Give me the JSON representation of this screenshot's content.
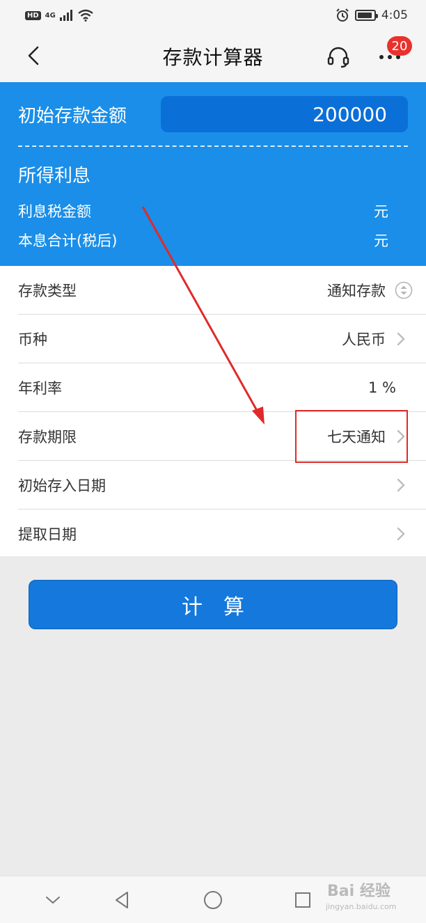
{
  "status_bar": {
    "hd_label": "HD",
    "network_label": "4G",
    "time": "4:05",
    "battery_level": 0.9
  },
  "nav": {
    "title": "存款计算器",
    "badge_count": "20"
  },
  "summary": {
    "amount_label": "初始存款金额",
    "amount_value": "200000",
    "interest_title": "所得利息",
    "tax_label": "利息税金额",
    "tax_unit": "元",
    "total_label": "本息合计(税后)",
    "total_unit": "元"
  },
  "form": {
    "rows": [
      {
        "label": "存款类型",
        "value": "通知存款"
      },
      {
        "label": "币种",
        "value": "人民币"
      },
      {
        "label": "年利率",
        "value": "1 %"
      },
      {
        "label": "存款期限",
        "value": "七天通知"
      },
      {
        "label": "初始存入日期",
        "value": ""
      },
      {
        "label": "提取日期",
        "value": ""
      }
    ]
  },
  "calculate_button": "计　算",
  "watermark": {
    "text": "Bai 经验",
    "url": "jingyan.baidu.com"
  },
  "colors": {
    "primary_blue": "#1a8ee8",
    "button_blue": "#1478dc",
    "annotation_red": "#e02a2a",
    "badge_red": "#e8322e"
  }
}
